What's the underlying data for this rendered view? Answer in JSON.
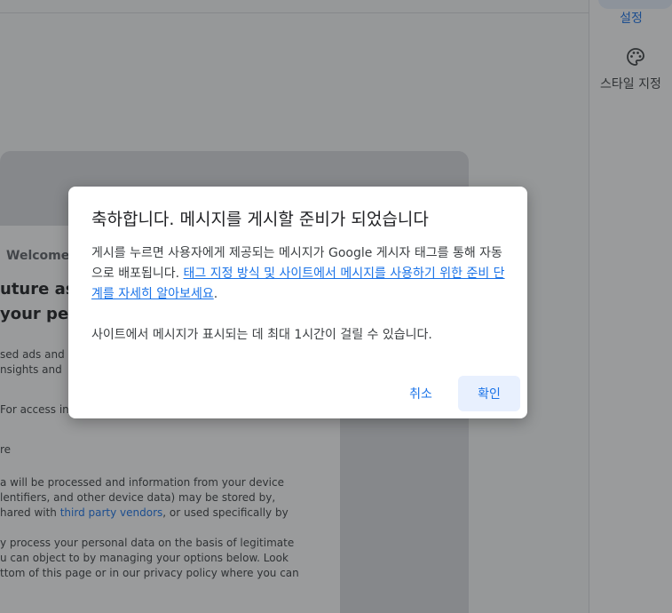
{
  "sidebar": {
    "settings_label": "설정",
    "style_label": "스타일 지정",
    "icons": {
      "style": "palette-icon"
    }
  },
  "consent_preview": {
    "welcome": "Welcome",
    "heading_line1": "uture as",
    "heading_line2": " your pe",
    "p1_line1": "sed ads and c",
    "p1_line2": "nsights and",
    "p2_line1": "For access int",
    "p3_line1": "re",
    "p4_line1": "a will be processed and information from your device",
    "p4_line2": "lentifiers, and other device data) may be stored by,",
    "p4_line3_before": "hared with ",
    "p4_line3_link": "third party vendors",
    "p4_line3_after": ", or used specifically by",
    "p5_line1": "y process your personal data on the basis of legitimate",
    "p5_line2": "u can object to by managing your options below. Look",
    "p5_line3": "ttom of this page or in our privacy policy where you can"
  },
  "dialog": {
    "title": "축하합니다. 메시지를 게시할 준비가 되었습니다",
    "body_text": "게시를 누르면 사용자에게 제공되는 메시지가 Google 게시자 태그를 통해 자동으로 배포됩니다. ",
    "body_link": "태그 지정 방식 및 사이트에서 메시지를 사용하기 위한 준비 단계를 자세히 알아보세요",
    "body_period": ".",
    "note": "사이트에서 메시지가 표시되는 데 최대 1시간이 걸릴 수 있습니다.",
    "cancel_label": "취소",
    "ok_label": "확인"
  },
  "colors": {
    "accent": "#1a73e8",
    "ok_button_bg": "#e8f0fe",
    "scrim": "rgba(32,33,36,0.45)"
  }
}
